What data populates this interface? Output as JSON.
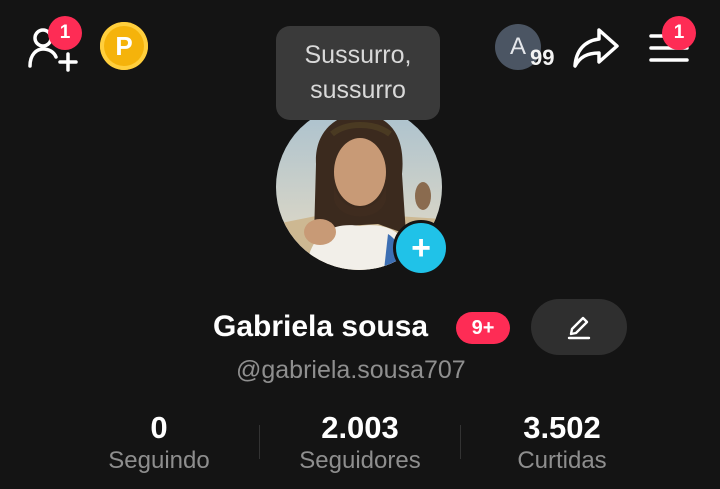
{
  "top_bar": {
    "add_friends_badge": "1",
    "coin_label": "P",
    "account_initial": "A",
    "account_count": "99",
    "menu_badge": "1"
  },
  "tooltip": {
    "line1": "Sussurro,",
    "line2": "sussurro"
  },
  "profile": {
    "name": "Gabriela sousa",
    "name_badge": "9+",
    "handle": "@gabriela.sousa707"
  },
  "stats": [
    {
      "value": "0",
      "label": "Seguindo"
    },
    {
      "value": "2.003",
      "label": "Seguidores"
    },
    {
      "value": "3.502",
      "label": "Curtidas"
    }
  ],
  "colors": {
    "background": "#141414",
    "badge": "#fe2c55",
    "coin": "#f5b30b",
    "add_photo": "#20c2e8"
  }
}
